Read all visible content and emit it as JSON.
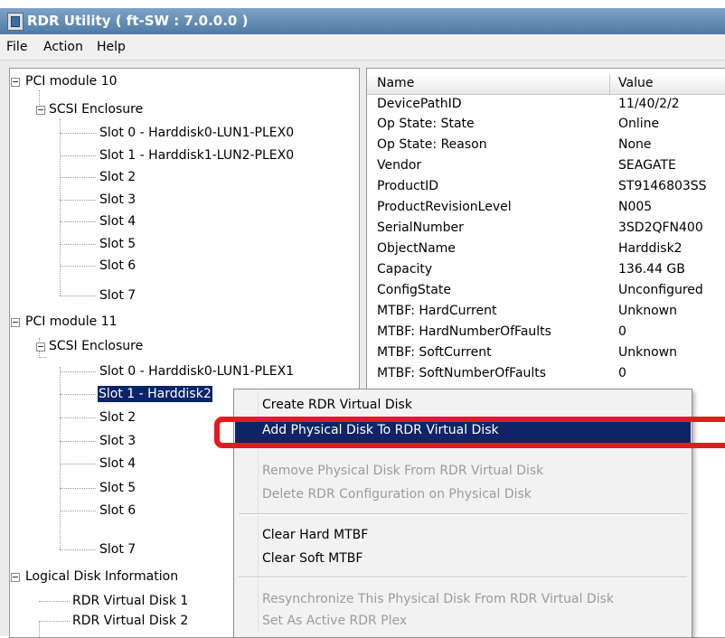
{
  "window": {
    "title": "RDR Utility  ( ft-SW : 7.0.0.0 )"
  },
  "menu": [
    "File",
    "Action",
    "Help"
  ],
  "tree": {
    "pci10": "PCI module 10",
    "enc10": "SCSI Enclosure",
    "slots10": [
      "Slot 0  -  Harddisk0-LUN1-PLEX0",
      "Slot 1  -  Harddisk1-LUN2-PLEX0",
      "Slot 2",
      "Slot 3",
      "Slot 4",
      "Slot 5",
      "Slot 6",
      "Slot 7"
    ],
    "pci11": "PCI module 11",
    "enc11": "SCSI Enclosure",
    "slots11": [
      "Slot 0  -  Harddisk0-LUN1-PLEX1",
      "Slot 1  -  Harddisk2",
      "Slot 2",
      "Slot 3",
      "Slot 4",
      "Slot 5",
      "Slot 6",
      "Slot 7"
    ],
    "logical": "Logical Disk Information",
    "vdisks": [
      "RDR Virtual Disk 1",
      "RDR Virtual Disk 2"
    ]
  },
  "properties": {
    "col_name": "Name",
    "col_value": "Value",
    "rows": [
      {
        "name": "DevicePathID",
        "value": "11/40/2/2"
      },
      {
        "name": "Op State: State",
        "value": "Online"
      },
      {
        "name": "Op State: Reason",
        "value": "None"
      },
      {
        "name": "Vendor",
        "value": "SEAGATE"
      },
      {
        "name": "ProductID",
        "value": "ST9146803SS"
      },
      {
        "name": "ProductRevisionLevel",
        "value": "N005"
      },
      {
        "name": "SerialNumber",
        "value": "3SD2QFN400"
      },
      {
        "name": "ObjectName",
        "value": "Harddisk2"
      },
      {
        "name": "Capacity",
        "value": "136.44 GB"
      },
      {
        "name": "ConfigState",
        "value": "Unconfigured"
      },
      {
        "name": "MTBF: HardCurrent",
        "value": "Unknown"
      },
      {
        "name": "MTBF: HardNumberOfFaults",
        "value": "0"
      },
      {
        "name": "MTBF: SoftCurrent",
        "value": "Unknown"
      },
      {
        "name": "MTBF: SoftNumberOfFaults",
        "value": "0"
      }
    ]
  },
  "context_menu": {
    "create": "Create RDR Virtual Disk",
    "add": "Add Physical Disk To RDR Virtual Disk",
    "remove": "Remove Physical Disk From RDR Virtual Disk",
    "delete": "Delete RDR Configuration on Physical Disk",
    "clear_hard": "Clear Hard MTBF",
    "clear_soft": "Clear Soft MTBF",
    "resync": "Resynchronize This Physical Disk From RDR Virtual Disk",
    "set_active": "Set As Active RDR Plex"
  },
  "colors": {
    "selection": "#0a246a",
    "highlight": "#0f2366",
    "callout": "#e8191e",
    "title_bar": "#4f7aa5"
  }
}
